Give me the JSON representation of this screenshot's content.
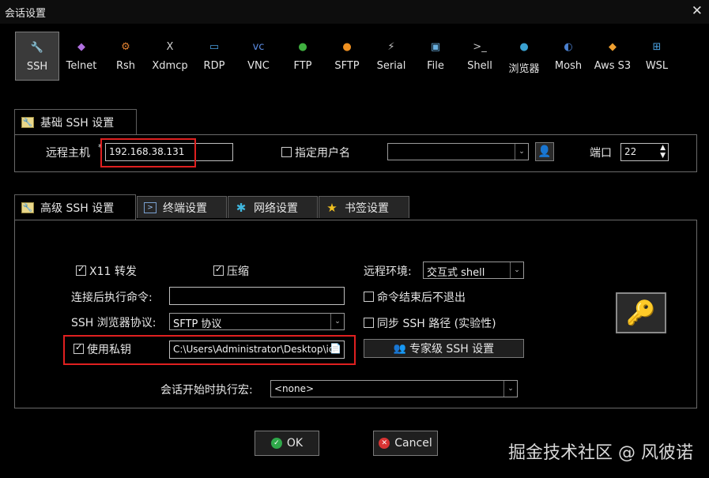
{
  "window": {
    "title": "会话设置",
    "close_glyph": "✕"
  },
  "toolbar": {
    "items": [
      {
        "label": "SSH",
        "icon": "ssh-key-icon",
        "glyph": "🔧",
        "color": "#e8d470"
      },
      {
        "label": "Telnet",
        "icon": "telnet-icon",
        "glyph": "◆",
        "color": "#b070e0"
      },
      {
        "label": "Rsh",
        "icon": "rsh-icon",
        "glyph": "⚙",
        "color": "#e08030"
      },
      {
        "label": "Xdmcp",
        "icon": "xdmcp-icon",
        "glyph": "X",
        "color": "#d0d0d0"
      },
      {
        "label": "RDP",
        "icon": "rdp-icon",
        "glyph": "▭",
        "color": "#4aa0e0"
      },
      {
        "label": "VNC",
        "icon": "vnc-icon",
        "glyph": "vc",
        "color": "#5a8ae0"
      },
      {
        "label": "FTP",
        "icon": "ftp-icon",
        "glyph": "●",
        "color": "#40b040"
      },
      {
        "label": "SFTP",
        "icon": "sftp-icon",
        "glyph": "●",
        "color": "#f09020"
      },
      {
        "label": "Serial",
        "icon": "serial-icon",
        "glyph": "⚡",
        "color": "#c0c0c0"
      },
      {
        "label": "File",
        "icon": "file-icon",
        "glyph": "▣",
        "color": "#6ab0e0"
      },
      {
        "label": "Shell",
        "icon": "shell-icon",
        "glyph": ">_",
        "color": "#c0c0c0"
      },
      {
        "label": "浏览器",
        "icon": "browser-icon",
        "glyph": "●",
        "color": "#3aa0d0"
      },
      {
        "label": "Mosh",
        "icon": "mosh-icon",
        "glyph": "◐",
        "color": "#4a80d0"
      },
      {
        "label": "Aws S3",
        "icon": "aws-s3-icon",
        "glyph": "◆",
        "color": "#f0a030"
      },
      {
        "label": "WSL",
        "icon": "wsl-icon",
        "glyph": "⊞",
        "color": "#4aa0e0"
      }
    ]
  },
  "basic": {
    "tab_label": "基础 SSH 设置",
    "remote_host_label": "远程主机",
    "remote_host_value": "192.168.38.131",
    "remote_host_required": "*",
    "specify_user_label": "指定用户名",
    "port_label": "端口",
    "port_value": "22"
  },
  "tabs": {
    "advanced": "高级 SSH 设置",
    "terminal": "终端设置",
    "network": "网络设置",
    "bookmark": "书签设置"
  },
  "advanced": {
    "x11_label": "X11 转发",
    "compress_label": "压缩",
    "remote_env_label": "远程环境:",
    "remote_env_value": "交互式 shell",
    "exec_cmd_label": "连接后执行命令:",
    "exec_cmd_value": "",
    "no_exit_label": "命令结束后不退出",
    "browser_proto_label": "SSH 浏览器协议:",
    "browser_proto_value": "SFTP 协议",
    "sync_path_label": "同步 SSH 路径 (实验性)",
    "use_key_label": "使用私钥",
    "key_path_value": "C:\\Users\\Administrator\\Desktop\\id",
    "expert_button": "专家级 SSH 设置",
    "macro_label": "会话开始时执行宏:",
    "macro_value": "<none>"
  },
  "buttons": {
    "ok": "OK",
    "cancel": "Cancel"
  },
  "watermark": "掘金技术社区 @ 风彼诺"
}
